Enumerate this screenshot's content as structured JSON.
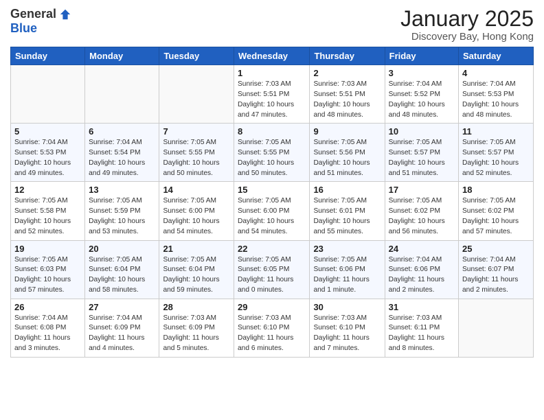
{
  "header": {
    "logo_general": "General",
    "logo_blue": "Blue",
    "month_title": "January 2025",
    "location": "Discovery Bay, Hong Kong"
  },
  "weekdays": [
    "Sunday",
    "Monday",
    "Tuesday",
    "Wednesday",
    "Thursday",
    "Friday",
    "Saturday"
  ],
  "weeks": [
    [
      {
        "day": "",
        "info": ""
      },
      {
        "day": "",
        "info": ""
      },
      {
        "day": "",
        "info": ""
      },
      {
        "day": "1",
        "info": "Sunrise: 7:03 AM\nSunset: 5:51 PM\nDaylight: 10 hours\nand 47 minutes."
      },
      {
        "day": "2",
        "info": "Sunrise: 7:03 AM\nSunset: 5:51 PM\nDaylight: 10 hours\nand 48 minutes."
      },
      {
        "day": "3",
        "info": "Sunrise: 7:04 AM\nSunset: 5:52 PM\nDaylight: 10 hours\nand 48 minutes."
      },
      {
        "day": "4",
        "info": "Sunrise: 7:04 AM\nSunset: 5:53 PM\nDaylight: 10 hours\nand 48 minutes."
      }
    ],
    [
      {
        "day": "5",
        "info": "Sunrise: 7:04 AM\nSunset: 5:53 PM\nDaylight: 10 hours\nand 49 minutes."
      },
      {
        "day": "6",
        "info": "Sunrise: 7:04 AM\nSunset: 5:54 PM\nDaylight: 10 hours\nand 49 minutes."
      },
      {
        "day": "7",
        "info": "Sunrise: 7:05 AM\nSunset: 5:55 PM\nDaylight: 10 hours\nand 50 minutes."
      },
      {
        "day": "8",
        "info": "Sunrise: 7:05 AM\nSunset: 5:55 PM\nDaylight: 10 hours\nand 50 minutes."
      },
      {
        "day": "9",
        "info": "Sunrise: 7:05 AM\nSunset: 5:56 PM\nDaylight: 10 hours\nand 51 minutes."
      },
      {
        "day": "10",
        "info": "Sunrise: 7:05 AM\nSunset: 5:57 PM\nDaylight: 10 hours\nand 51 minutes."
      },
      {
        "day": "11",
        "info": "Sunrise: 7:05 AM\nSunset: 5:57 PM\nDaylight: 10 hours\nand 52 minutes."
      }
    ],
    [
      {
        "day": "12",
        "info": "Sunrise: 7:05 AM\nSunset: 5:58 PM\nDaylight: 10 hours\nand 52 minutes."
      },
      {
        "day": "13",
        "info": "Sunrise: 7:05 AM\nSunset: 5:59 PM\nDaylight: 10 hours\nand 53 minutes."
      },
      {
        "day": "14",
        "info": "Sunrise: 7:05 AM\nSunset: 6:00 PM\nDaylight: 10 hours\nand 54 minutes."
      },
      {
        "day": "15",
        "info": "Sunrise: 7:05 AM\nSunset: 6:00 PM\nDaylight: 10 hours\nand 54 minutes."
      },
      {
        "day": "16",
        "info": "Sunrise: 7:05 AM\nSunset: 6:01 PM\nDaylight: 10 hours\nand 55 minutes."
      },
      {
        "day": "17",
        "info": "Sunrise: 7:05 AM\nSunset: 6:02 PM\nDaylight: 10 hours\nand 56 minutes."
      },
      {
        "day": "18",
        "info": "Sunrise: 7:05 AM\nSunset: 6:02 PM\nDaylight: 10 hours\nand 57 minutes."
      }
    ],
    [
      {
        "day": "19",
        "info": "Sunrise: 7:05 AM\nSunset: 6:03 PM\nDaylight: 10 hours\nand 57 minutes."
      },
      {
        "day": "20",
        "info": "Sunrise: 7:05 AM\nSunset: 6:04 PM\nDaylight: 10 hours\nand 58 minutes."
      },
      {
        "day": "21",
        "info": "Sunrise: 7:05 AM\nSunset: 6:04 PM\nDaylight: 10 hours\nand 59 minutes."
      },
      {
        "day": "22",
        "info": "Sunrise: 7:05 AM\nSunset: 6:05 PM\nDaylight: 11 hours\nand 0 minutes."
      },
      {
        "day": "23",
        "info": "Sunrise: 7:05 AM\nSunset: 6:06 PM\nDaylight: 11 hours\nand 1 minute."
      },
      {
        "day": "24",
        "info": "Sunrise: 7:04 AM\nSunset: 6:06 PM\nDaylight: 11 hours\nand 2 minutes."
      },
      {
        "day": "25",
        "info": "Sunrise: 7:04 AM\nSunset: 6:07 PM\nDaylight: 11 hours\nand 2 minutes."
      }
    ],
    [
      {
        "day": "26",
        "info": "Sunrise: 7:04 AM\nSunset: 6:08 PM\nDaylight: 11 hours\nand 3 minutes."
      },
      {
        "day": "27",
        "info": "Sunrise: 7:04 AM\nSunset: 6:09 PM\nDaylight: 11 hours\nand 4 minutes."
      },
      {
        "day": "28",
        "info": "Sunrise: 7:03 AM\nSunset: 6:09 PM\nDaylight: 11 hours\nand 5 minutes."
      },
      {
        "day": "29",
        "info": "Sunrise: 7:03 AM\nSunset: 6:10 PM\nDaylight: 11 hours\nand 6 minutes."
      },
      {
        "day": "30",
        "info": "Sunrise: 7:03 AM\nSunset: 6:10 PM\nDaylight: 11 hours\nand 7 minutes."
      },
      {
        "day": "31",
        "info": "Sunrise: 7:03 AM\nSunset: 6:11 PM\nDaylight: 11 hours\nand 8 minutes."
      },
      {
        "day": "",
        "info": ""
      }
    ]
  ]
}
